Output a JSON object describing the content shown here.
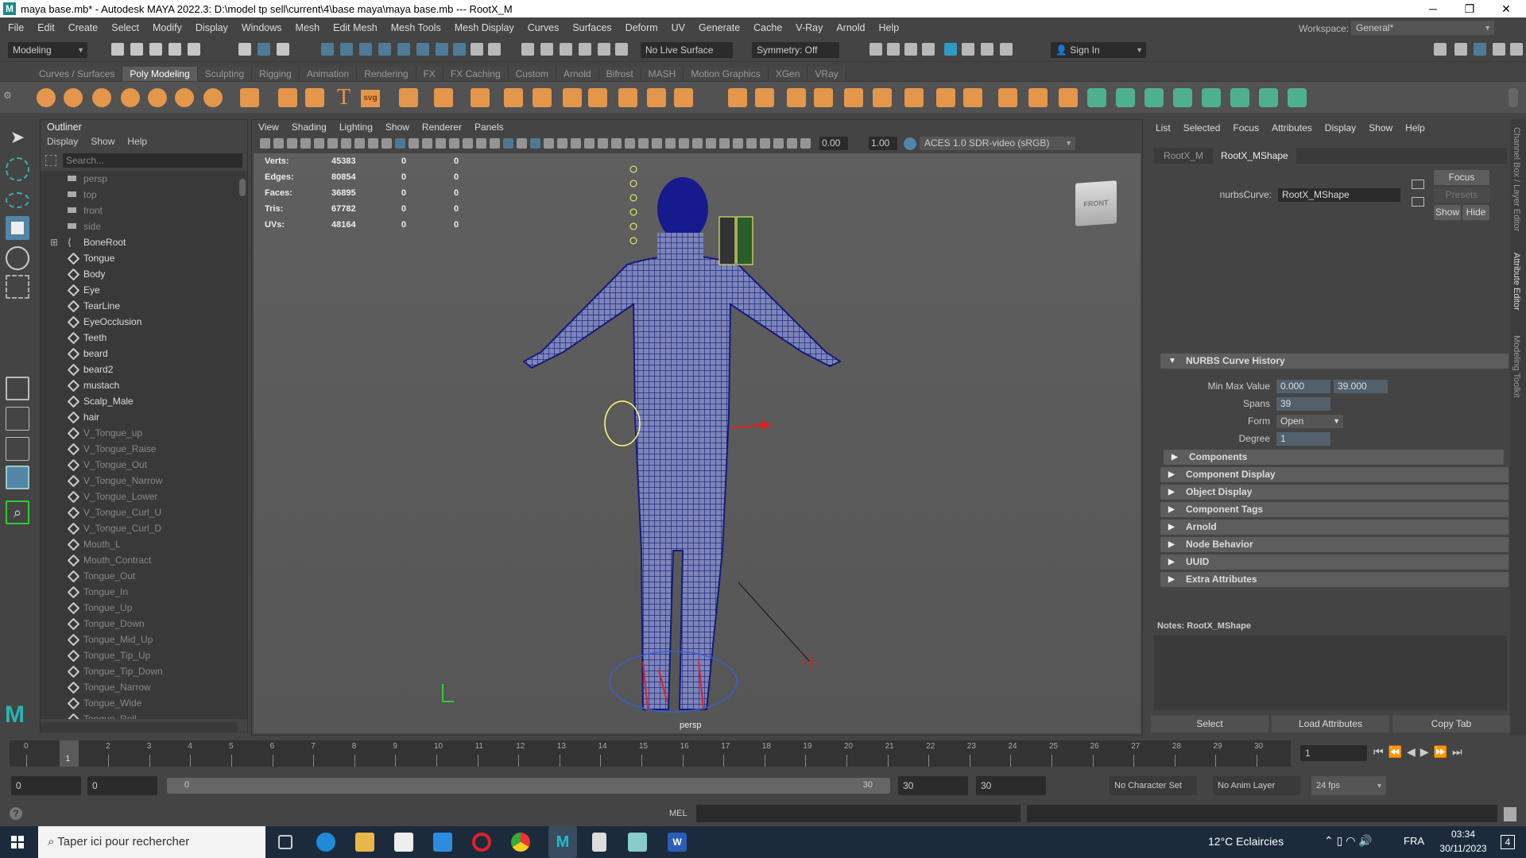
{
  "window": {
    "title": "maya base.mb* - Autodesk MAYA 2022.3: D:\\model tp sell\\current\\4\\base maya\\maya base.mb  ---  RootX_M",
    "logo": "M",
    "minimize": "─",
    "maximize": "❐",
    "close": "✕"
  },
  "menubar": [
    "File",
    "Edit",
    "Create",
    "Select",
    "Modify",
    "Display",
    "Windows",
    "Mesh",
    "Edit Mesh",
    "Mesh Tools",
    "Mesh Display",
    "Curves",
    "Surfaces",
    "Deform",
    "UV",
    "Generate",
    "Cache",
    "V-Ray",
    "Arnold",
    "Help"
  ],
  "statusline": {
    "mode": "Modeling",
    "live_surface": "No Live Surface",
    "symmetry": "Symmetry: Off",
    "sign_in": "Sign In",
    "workspace_label": "Workspace:",
    "workspace": "General*"
  },
  "shelf": {
    "tabs": [
      "Curves / Surfaces",
      "Poly Modeling",
      "Sculpting",
      "Rigging",
      "Animation",
      "Rendering",
      "FX",
      "FX Caching",
      "Custom",
      "Arnold",
      "Bifrost",
      "MASH",
      "Motion Graphics",
      "XGen",
      "VRay"
    ],
    "active": "Poly Modeling",
    "text_icon": "T",
    "svg_icon": "svg"
  },
  "outliner": {
    "title": "Outliner",
    "menu": [
      "Display",
      "Show",
      "Help"
    ],
    "search_placeholder": "Search...",
    "items": [
      {
        "label": "persp",
        "type": "camera",
        "dim": true
      },
      {
        "label": "top",
        "type": "camera",
        "dim": true
      },
      {
        "label": "front",
        "type": "camera",
        "dim": true
      },
      {
        "label": "side",
        "type": "camera",
        "dim": true
      },
      {
        "label": "BoneRoot",
        "type": "joint",
        "dim": false
      },
      {
        "label": "Tongue",
        "type": "mesh",
        "dim": false
      },
      {
        "label": "Body",
        "type": "mesh",
        "dim": false
      },
      {
        "label": "Eye",
        "type": "mesh",
        "dim": false
      },
      {
        "label": "TearLine",
        "type": "mesh",
        "dim": false
      },
      {
        "label": "EyeOcclusion",
        "type": "mesh",
        "dim": false
      },
      {
        "label": "Teeth",
        "type": "mesh",
        "dim": false
      },
      {
        "label": "beard",
        "type": "mesh",
        "dim": false
      },
      {
        "label": "beard2",
        "type": "mesh",
        "dim": false
      },
      {
        "label": "mustach",
        "type": "mesh",
        "dim": false
      },
      {
        "label": "Scalp_Male",
        "type": "mesh",
        "dim": false
      },
      {
        "label": "hair",
        "type": "mesh",
        "dim": false
      },
      {
        "label": "V_Tongue_up",
        "type": "mesh",
        "dim": true
      },
      {
        "label": "V_Tongue_Raise",
        "type": "mesh",
        "dim": true
      },
      {
        "label": "V_Tongue_Out",
        "type": "mesh",
        "dim": true
      },
      {
        "label": "V_Tongue_Narrow",
        "type": "mesh",
        "dim": true
      },
      {
        "label": "V_Tongue_Lower",
        "type": "mesh",
        "dim": true
      },
      {
        "label": "V_Tongue_Curl_U",
        "type": "mesh",
        "dim": true
      },
      {
        "label": "V_Tongue_Curl_D",
        "type": "mesh",
        "dim": true
      },
      {
        "label": "Mouth_L",
        "type": "mesh",
        "dim": true
      },
      {
        "label": "Mouth_Contract",
        "type": "mesh",
        "dim": true
      },
      {
        "label": "Tongue_Out",
        "type": "mesh",
        "dim": true
      },
      {
        "label": "Tongue_In",
        "type": "mesh",
        "dim": true
      },
      {
        "label": "Tongue_Up",
        "type": "mesh",
        "dim": true
      },
      {
        "label": "Tongue_Down",
        "type": "mesh",
        "dim": true
      },
      {
        "label": "Tongue_Mid_Up",
        "type": "mesh",
        "dim": true
      },
      {
        "label": "Tongue_Tip_Up",
        "type": "mesh",
        "dim": true
      },
      {
        "label": "Tongue_Tip_Down",
        "type": "mesh",
        "dim": true
      },
      {
        "label": "Tongue_Narrow",
        "type": "mesh",
        "dim": true
      },
      {
        "label": "Tongue_Wide",
        "type": "mesh",
        "dim": true
      },
      {
        "label": "Tongue_Roll",
        "type": "mesh",
        "dim": true
      }
    ]
  },
  "viewport": {
    "menu": [
      "View",
      "Shading",
      "Lighting",
      "Show",
      "Renderer",
      "Panels"
    ],
    "exposure": "0.00",
    "gamma": "1.00",
    "color_space": "ACES 1.0 SDR-video (sRGB)",
    "hud": [
      {
        "label": "Verts:",
        "v": "45383",
        "a": "0",
        "b": "0"
      },
      {
        "label": "Edges:",
        "v": "80854",
        "a": "0",
        "b": "0"
      },
      {
        "label": "Faces:",
        "v": "36895",
        "a": "0",
        "b": "0"
      },
      {
        "label": "Tris:",
        "v": "67782",
        "a": "0",
        "b": "0"
      },
      {
        "label": "UVs:",
        "v": "48164",
        "a": "0",
        "b": "0"
      }
    ],
    "viewcube": "FRONT",
    "camera": "persp"
  },
  "attr": {
    "menu": [
      "List",
      "Selected",
      "Focus",
      "Attributes",
      "Display",
      "Show",
      "Help"
    ],
    "tabs": [
      "RootX_M",
      "RootX_MShape"
    ],
    "node_label": "nurbsCurve:",
    "node_value": "RootX_MShape",
    "focus": "Focus",
    "presets": "Presets",
    "show": "Show",
    "hide": "Hide",
    "history": {
      "title": "NURBS Curve History",
      "minmax_label": "Min Max Value",
      "min": "0.000",
      "max": "39.000",
      "spans_label": "Spans",
      "spans": "39",
      "form_label": "Form",
      "form": "Open",
      "degree_label": "Degree",
      "degree": "1"
    },
    "sections": [
      "Components",
      "Component Display",
      "Object Display",
      "Component Tags",
      "Arnold",
      "Node Behavior",
      "UUID",
      "Extra Attributes"
    ],
    "notes": "Notes:  RootX_MShape",
    "select": "Select",
    "load": "Load Attributes",
    "copy": "Copy Tab"
  },
  "side_tabs": [
    "Channel Box / Layer Editor",
    "Attribute Editor",
    "Modeling Toolkit"
  ],
  "timeline": {
    "ticks": [
      "0",
      "1",
      "2",
      "3",
      "4",
      "5",
      "6",
      "7",
      "8",
      "9",
      "10",
      "11",
      "12",
      "13",
      "14",
      "15",
      "16",
      "17",
      "18",
      "19",
      "20",
      "21",
      "22",
      "23",
      "24",
      "25",
      "26",
      "27",
      "28",
      "29",
      "30"
    ],
    "current": "1",
    "current_field": "1"
  },
  "range": {
    "start": "0",
    "anim_start": "0",
    "slider_start": "0",
    "slider_end": "30",
    "end": "30",
    "anim_end": "30",
    "character_set": "No Character Set",
    "anim_layer": "No Anim Layer",
    "fps": "24 fps"
  },
  "cmd": {
    "lang": "MEL",
    "help": "?"
  },
  "taskbar": {
    "search": "Taper ici pour rechercher",
    "weather": "12°C  Eclaircies",
    "lang": "FRA",
    "time": "03:34",
    "date": "30/11/2023",
    "notif": "4"
  }
}
